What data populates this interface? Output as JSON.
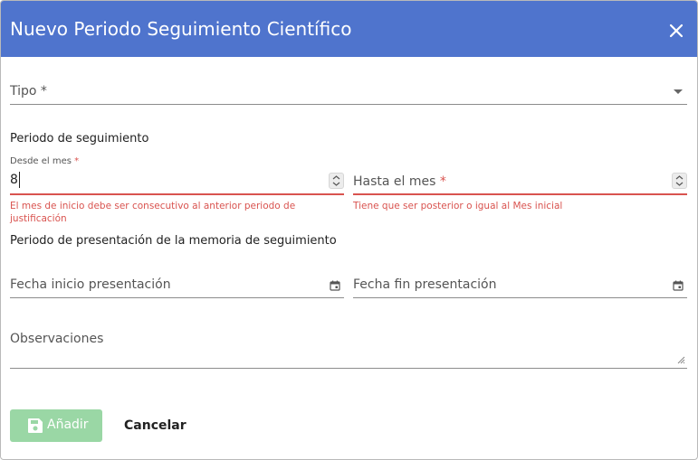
{
  "dialog": {
    "title": "Nuevo Periodo Seguimiento Científico",
    "close_icon": "close-icon"
  },
  "form": {
    "tipo": {
      "label": "Tipo *"
    },
    "periodo_seguimiento": {
      "title": "Periodo de seguimiento"
    },
    "desde": {
      "label": "Desde el mes",
      "required_mark": "*",
      "value": "8",
      "error": "El mes de inicio debe ser consecutivo al anterior periodo de justificación"
    },
    "hasta": {
      "label": "Hasta el mes",
      "required_mark": "*",
      "error": "Tiene que ser posterior o igual al Mes inicial"
    },
    "presentacion": {
      "title": "Periodo de presentación de la memoria de seguimiento"
    },
    "fecha_inicio": {
      "label": "Fecha inicio presentación"
    },
    "fecha_fin": {
      "label": "Fecha fin presentación"
    },
    "observaciones": {
      "label": "Observaciones"
    }
  },
  "actions": {
    "add_label": "Añadir",
    "cancel_label": "Cancelar"
  },
  "colors": {
    "header": "#4f74cd",
    "error": "#d9534f",
    "add_button": "#9ad7a5"
  }
}
